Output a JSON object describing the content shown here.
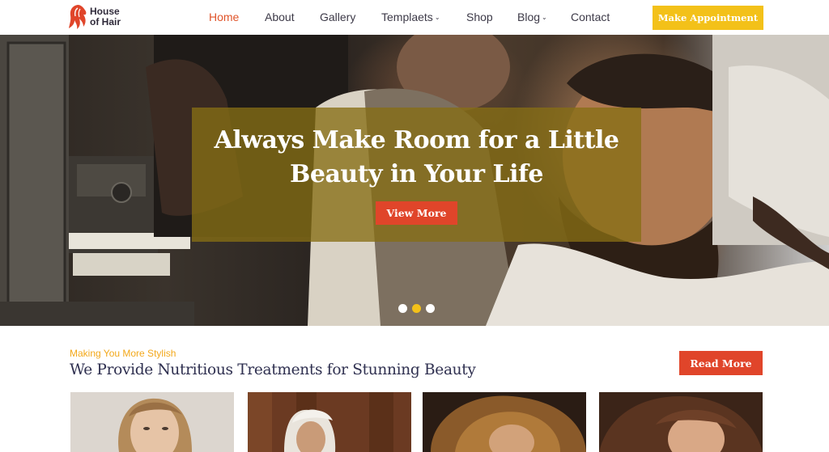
{
  "header": {
    "logo_line1": "House",
    "logo_line2": "of Hair",
    "nav": [
      {
        "label": "Home",
        "active": true,
        "dropdown": false
      },
      {
        "label": "About",
        "active": false,
        "dropdown": false
      },
      {
        "label": "Gallery",
        "active": false,
        "dropdown": false
      },
      {
        "label": "Templaets",
        "active": false,
        "dropdown": true
      },
      {
        "label": "Shop",
        "active": false,
        "dropdown": false
      },
      {
        "label": "Blog",
        "active": false,
        "dropdown": true
      },
      {
        "label": "Contact",
        "active": false,
        "dropdown": false
      }
    ],
    "cta_label": "Make Appointment"
  },
  "hero": {
    "title_line1": "Always Make Room for a Little",
    "title_line2": "Beauty in Your Life",
    "button_label": "View More",
    "slides": 3,
    "active_slide": 2
  },
  "section": {
    "kicker": "Making You More Stylish",
    "title": "We Provide Nutritious Treatments for Stunning Beauty",
    "button_label": "Read More",
    "cards": [
      {
        "icon": "portrait-blonde-woman-image"
      },
      {
        "icon": "portrait-towel-woman-image"
      },
      {
        "icon": "portrait-curly-hair-image"
      },
      {
        "icon": "portrait-brunette-woman-image"
      }
    ]
  },
  "colors": {
    "accent_orange": "#e0452a",
    "accent_yellow": "#f3c119",
    "heading_navy": "#2f3050",
    "kicker_gold": "#f3a81a"
  }
}
